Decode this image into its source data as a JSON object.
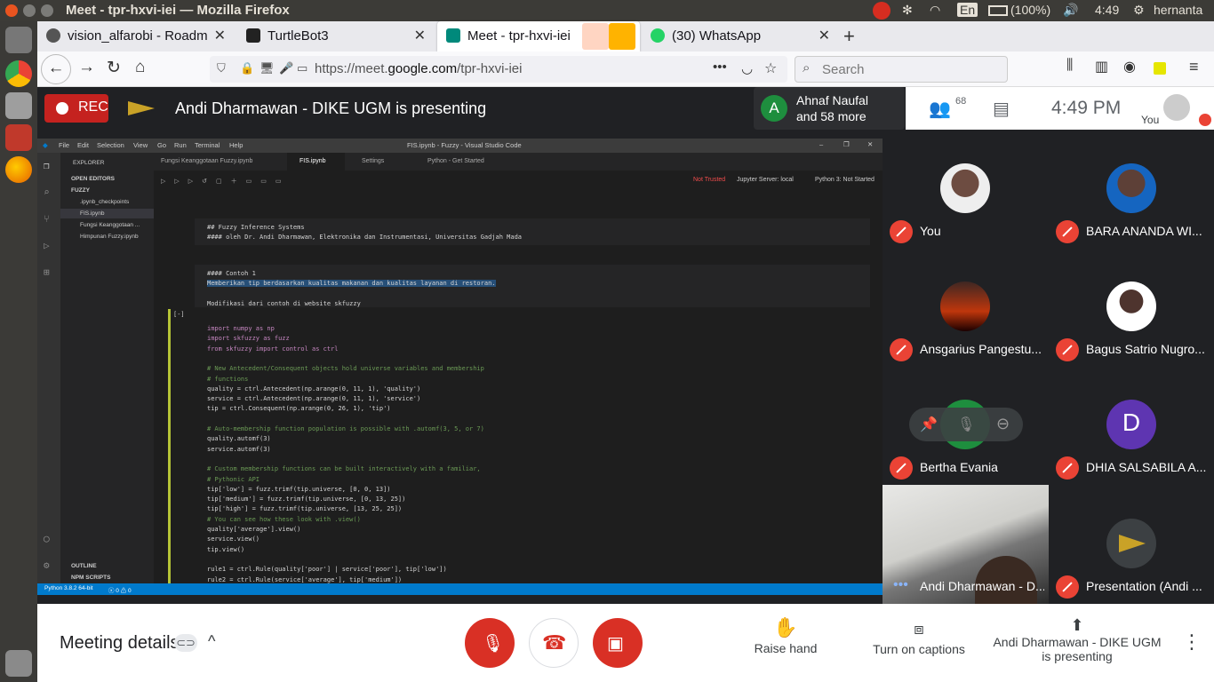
{
  "os": {
    "window_title": "Meet - tpr-hxvi-iei — Mozilla Firefox",
    "keyboard_layout": "En",
    "battery": "(100%)",
    "clock": "4:49",
    "username": "hernanta"
  },
  "browser": {
    "tabs": [
      {
        "label": "vision_alfarobi - Roadm",
        "icon_color": "#555555",
        "active": false
      },
      {
        "label": "TurtleBot3",
        "icon_color": "#222222",
        "active": false
      },
      {
        "label": "Meet - tpr-hxvi-iei",
        "icon_color": "#00897b",
        "active": true
      },
      {
        "label": "(30) WhatsApp",
        "icon_color": "#25d366",
        "active": false
      }
    ],
    "url_prefix": "https://meet.",
    "url_domain": "google.com",
    "url_path": "/tpr-hxvi-iei",
    "search_placeholder": "Search"
  },
  "meet": {
    "rec_label": "REC",
    "presenting_banner": "Andi Dharmawan - DIKE UGM is presenting",
    "joined": {
      "initial": "A",
      "line1": "Ahnaf Naufal",
      "line2": "and 58 more"
    },
    "participant_count": "68",
    "time": "4:49 PM",
    "self_label": "You",
    "participants": [
      {
        "name": "You",
        "avatar": "photo",
        "muted": true
      },
      {
        "name": "BARA ANANDA WI...",
        "avatar": "photo",
        "muted": true
      },
      {
        "name": "Ansgarius Pangestu...",
        "avatar": "photo",
        "muted": true
      },
      {
        "name": "Bagus Satrio Nugro...",
        "avatar": "photo",
        "muted": true
      },
      {
        "name": "Bertha Evania",
        "avatar": "photo",
        "muted": true
      },
      {
        "name": "DHIA SALSABILA A...",
        "avatar": "D",
        "muted": true
      },
      {
        "name": "Andi Dharmawan - D...",
        "avatar": "video",
        "muted": false
      },
      {
        "name": "Presentation (Andi ...",
        "avatar": "logo",
        "muted": true
      }
    ],
    "bottom": {
      "meeting_details": "Meeting details",
      "raise_hand": "Raise hand",
      "captions": "Turn on captions",
      "presenting_line1": "Andi Dharmawan - DIKE UGM",
      "presenting_line2": "is presenting"
    }
  },
  "vscode": {
    "menu": [
      "File",
      "Edit",
      "Selection",
      "View",
      "Go",
      "Run",
      "Terminal",
      "Help"
    ],
    "title": "FIS.ipynb - Fuzzy - Visual Studio Code",
    "explorer": "EXPLORER",
    "open_editors": "OPEN EDITORS",
    "folder": "FUZZY",
    "files": [
      ".ipynb_checkpoints",
      "FIS.ipynb",
      "Fungsi Keanggotaan ...",
      "Himpunan Fuzzy.ipynb"
    ],
    "outline": "OUTLINE",
    "npm": "NPM SCRIPTS",
    "tabs": [
      "Fungsi Keanggotaan Fuzzy.ipynb",
      "FIS.ipynb",
      "Settings",
      "Python - Get Started"
    ],
    "not_trusted": "Not Trusted",
    "jupyter_server": "Jupyter Server: local",
    "kernel": "Python 3: Not Started",
    "md1": [
      "## Fuzzy Inference Systems",
      "#### oleh Dr. Andi Dharmawan, Elektronika dan Instrumentasi, Universitas Gadjah Mada"
    ],
    "md2": [
      "#### Contoh 1",
      "Memberikan tip berdasarkan kualitas makanan dan kualitas layanan di restoran.",
      "",
      "Modifikasi dari contoh di website skfuzzy"
    ],
    "cell_prompt": "[-]",
    "code": [
      "import numpy as np",
      "import skfuzzy as fuzz",
      "from skfuzzy import control as ctrl",
      "",
      "# New Antecedent/Consequent objects hold universe variables and membership",
      "# functions",
      "quality = ctrl.Antecedent(np.arange(0, 11, 1), 'quality')",
      "service = ctrl.Antecedent(np.arange(0, 11, 1), 'service')",
      "tip = ctrl.Consequent(np.arange(0, 26, 1), 'tip')",
      "",
      "# Auto-membership function population is possible with .automf(3, 5, or 7)",
      "quality.automf(3)",
      "service.automf(3)",
      "",
      "# Custom membership functions can be built interactively with a familiar,",
      "# Pythonic API",
      "tip['low'] = fuzz.trimf(tip.universe, [0, 0, 13])",
      "tip['medium'] = fuzz.trimf(tip.universe, [0, 13, 25])",
      "tip['high'] = fuzz.trimf(tip.universe, [13, 25, 25])",
      "# You can see how these look with .view()",
      "quality['average'].view()",
      "service.view()",
      "tip.view()",
      "",
      "rule1 = ctrl.Rule(quality['poor'] | service['poor'], tip['low'])",
      "rule2 = ctrl.Rule(service['average'], tip['medium'])"
    ],
    "status_python": "Python 3.8.2 64-bit",
    "status_problems": "ⓧ 0 ⚠ 0"
  }
}
